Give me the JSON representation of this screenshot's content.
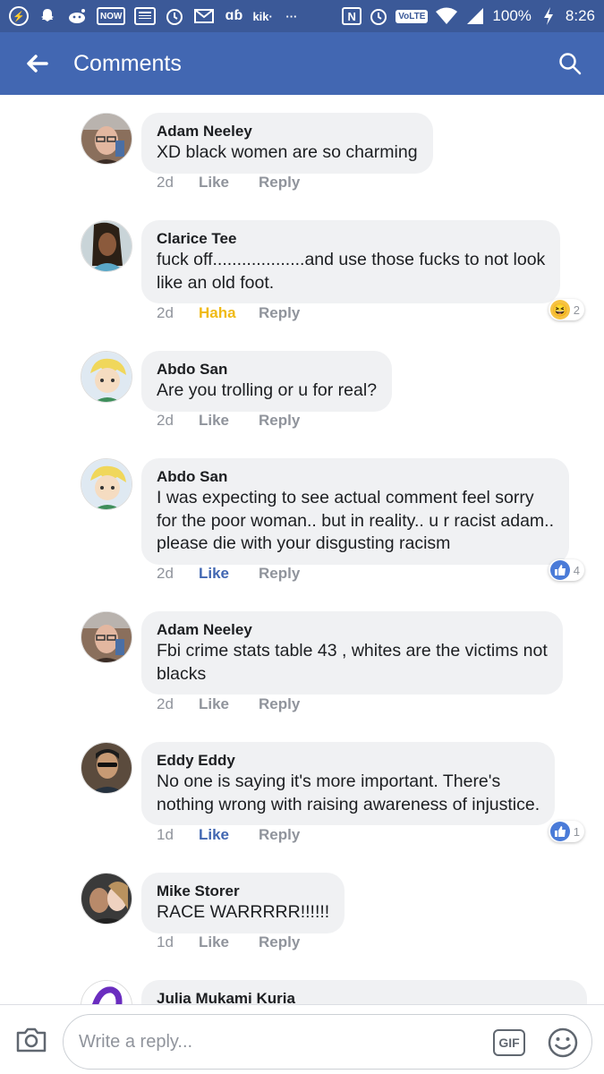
{
  "status_bar": {
    "icons": [
      "messenger-icon",
      "snapchat-icon",
      "reddit-icon",
      "now-icon",
      "news-icon",
      "alarm-icon",
      "gmail-icon",
      "dubsmash-icon",
      "kik-icon",
      "more-icon",
      "nfc-icon",
      "alarm-clock-icon",
      "wifi-icon",
      "signal-icon",
      "charging-icon"
    ],
    "now_label": "NOW",
    "kik_label": "kik·",
    "more_label": "···",
    "volte_label": "VoLTE",
    "battery": "100%",
    "time": "8:26"
  },
  "header": {
    "title": "Comments"
  },
  "comments": [
    {
      "author": "Adam Neeley",
      "text": "XD black women are so charming",
      "time": "2d",
      "like_label": "Like",
      "reply_label": "Reply",
      "like_state": "none",
      "reaction_count": null
    },
    {
      "author": "Clarice Tee",
      "text": "fuck off...................and use those fucks to not look\nlike an old foot.",
      "time": "2d",
      "like_label": "Haha",
      "reply_label": "Reply",
      "like_state": "haha",
      "reaction_type": "haha",
      "reaction_count": "2"
    },
    {
      "author": "Abdo San",
      "text": "Are you trolling or u for real?",
      "time": "2d",
      "like_label": "Like",
      "reply_label": "Reply",
      "like_state": "none",
      "reaction_count": null
    },
    {
      "author": "Abdo San",
      "text": "I was expecting to see actual comment feel sorry\nfor the poor woman.. but in reality.. u r racist adam..\nplease die with your disgusting racism",
      "time": "2d",
      "like_label": "Like",
      "reply_label": "Reply",
      "like_state": "liked",
      "reaction_type": "like",
      "reaction_count": "4"
    },
    {
      "author": "Adam Neeley",
      "text": "Fbi crime stats table 43 , whites are the victims not\nblacks",
      "time": "2d",
      "like_label": "Like",
      "reply_label": "Reply",
      "like_state": "none",
      "reaction_count": null
    },
    {
      "author": "Eddy Eddy",
      "text": "No one is saying it's more important. There's\nnothing wrong with raising awareness of injustice.",
      "time": "1d",
      "like_label": "Like",
      "reply_label": "Reply",
      "like_state": "liked",
      "reaction_type": "like",
      "reaction_count": "1"
    },
    {
      "author": "Mike Storer",
      "text": "RACE WARRRRR!!!!!!",
      "time": "1d",
      "like_label": "Like",
      "reply_label": "Reply",
      "like_state": "none",
      "reaction_count": null
    },
    {
      "author": "Julia Mukami Kuria",
      "text": "",
      "time": "",
      "like_label": "",
      "reply_label": "",
      "like_state": "none",
      "reaction_count": null
    }
  ],
  "composer": {
    "placeholder": "Write a reply...",
    "gif_label": "GIF"
  },
  "colors": {
    "header_blue": "#4267b2",
    "status_blue": "#3b5998",
    "liked_blue": "#4267b2",
    "haha_yellow": "#f0ba15",
    "bubble_grey": "#f0f1f3",
    "meta_grey": "#90949c"
  }
}
